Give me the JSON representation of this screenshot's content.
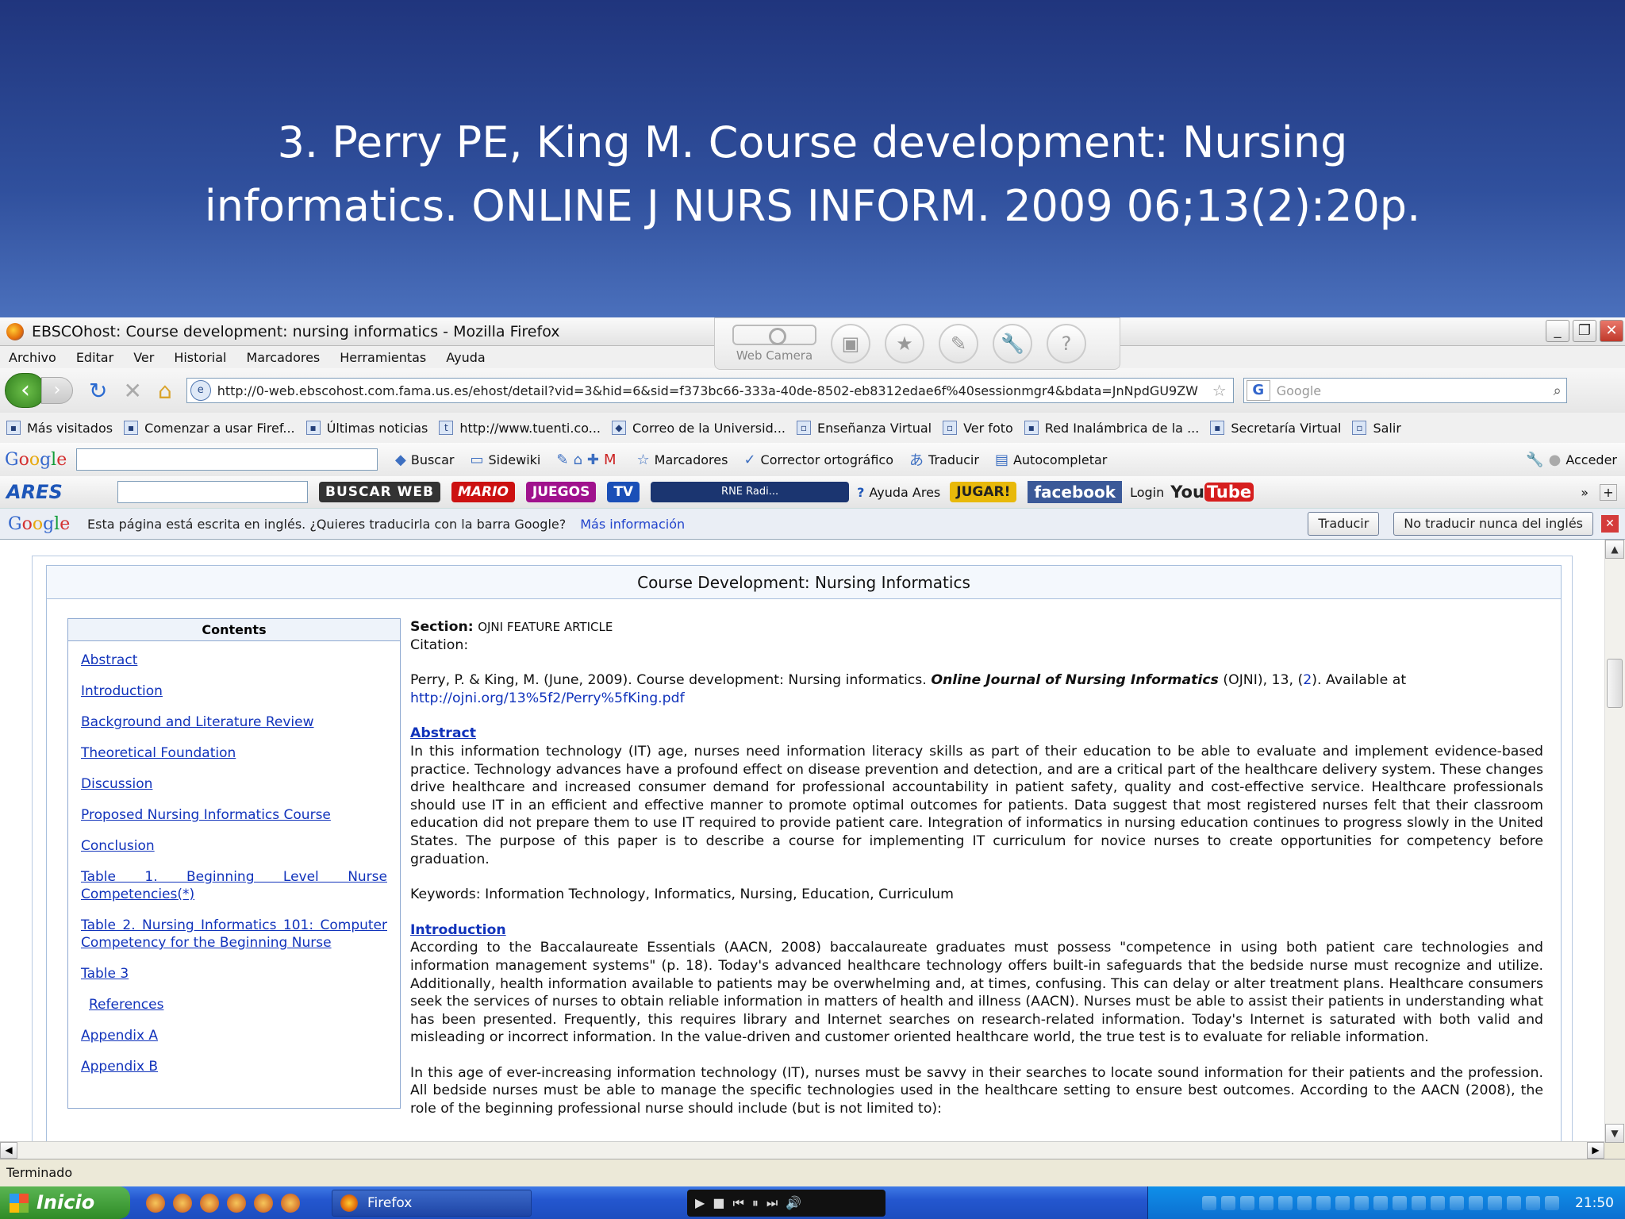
{
  "slide": {
    "title_line1": "3. Perry PE, King M. Course development: Nursing",
    "title_line2": "informatics. ONLINE J NURS INFORM. 2009 06;13(2):20p."
  },
  "window": {
    "title": "EBSCOhost: Course development: nursing informatics - Mozilla Firefox"
  },
  "webcam": {
    "label": "Web Camera"
  },
  "menu": [
    "Archivo",
    "Editar",
    "Ver",
    "Historial",
    "Marcadores",
    "Herramientas",
    "Ayuda"
  ],
  "nav": {
    "url": "http://0-web.ebscohost.com.fama.us.es/ehost/detail?vid=3&hid=6&sid=f373bc66-333a-40de-8502-eb8312edae6f%40sessionmgr4&bdata=JnNpdGU9ZW",
    "search_placeholder": "Google"
  },
  "bookmarks": [
    "Más visitados",
    "Comenzar a usar Firef...",
    "Últimas noticias",
    "http://www.tuenti.co...",
    "Correo de la Universid...",
    "Enseñanza Virtual",
    "Ver foto",
    "Red Inalámbrica de la ...",
    "Secretaría Virtual",
    "Salir"
  ],
  "google_toolbar": {
    "logo": "Google",
    "items": [
      "Buscar",
      "Sidewiki",
      "Marcadores",
      "Corrector ortográfico",
      "Traducir",
      "Autocompletar",
      "Acceder"
    ]
  },
  "ares_toolbar": {
    "logo": "ARES",
    "buscar": "BUSCAR WEB",
    "mario": "MARIO",
    "juegos": "JUEGOS",
    "tv": "TV",
    "radio": "RNE Radi...",
    "ayuda": "Ayuda Ares",
    "jugar": "JUGAR!",
    "facebook": "facebook",
    "login": "Login",
    "youtube_you": "You",
    "youtube_tube": "Tube"
  },
  "translate_bar": {
    "logo": "Google",
    "message": "Esta página está escrita en inglés. ¿Quieres traducirla con la barra Google?",
    "more": "Más información",
    "translate": "Traducir",
    "never": "No traducir nunca del inglés"
  },
  "doc": {
    "title": "Course Development: Nursing Informatics",
    "contents_title": "Contents",
    "contents": [
      "Abstract",
      "Introduction",
      "Background and Literature Review",
      "Theoretical Foundation",
      "Discussion",
      "Proposed Nursing Informatics Course",
      "Conclusion",
      "Table 1. Beginning Level Nurse Competencies(*)",
      "Table 2. Nursing Informatics 101: Computer Competency for the Beginning Nurse",
      "Table 3",
      "References",
      "Appendix A",
      "Appendix B"
    ],
    "section_label": "Section:",
    "section_value": "OJNI FEATURE ARTICLE",
    "citation_label": "Citation:",
    "citation_pre": "Perry, P. & King, M. (June, 2009). Course development: Nursing informatics.",
    "citation_journal": "Online Journal of Nursing Informatics",
    "citation_mid": "(OJNI), 13, (",
    "citation_issue": "2",
    "citation_post": "). Available at",
    "citation_url": "http://ojni.org/13%5f2/Perry%5fKing.pdf",
    "abstract_heading": "Abstract",
    "abstract_text": "In this information technology (IT) age, nurses need information literacy skills as part of their education to be able to evaluate and implement evidence-based practice. Technology advances have a profound effect on disease prevention and detection, and are a critical part of the healthcare delivery system. These changes drive healthcare and increased consumer demand for professional accountability in patient safety, quality and cost-effective service. Healthcare professionals should use IT in an efficient and effective manner to promote optimal outcomes for patients. Data suggest that most registered nurses felt that their classroom education did not prepare them to use IT required to provide patient care. Integration of informatics in nursing education continues to progress slowly in the United States. The purpose of this paper is to describe a course for implementing IT curriculum for novice nurses to create opportunities for competency before graduation.",
    "keywords": "Keywords: Information Technology, Informatics, Nursing, Education, Curriculum",
    "intro_heading": "Introduction",
    "intro_p1": "According to the Baccalaureate Essentials (AACN, 2008) baccalaureate graduates must possess \"competence in using both patient care technologies and information management systems\" (p. 18). Today's advanced healthcare technology offers built-in safeguards that the bedside nurse must recognize and utilize. Additionally, health information available to patients may be overwhelming and, at times, confusing. This can delay or alter treatment plans. Healthcare consumers seek the services of nurses to obtain reliable information in matters of health and illness (AACN). Nurses must be able to assist their patients in understanding what has been presented. Frequently, this requires library and Internet searches on research-related information. Today's Internet is saturated with both valid and misleading or incorrect information. In the value-driven and customer oriented healthcare world, the true test is to evaluate for reliable information.",
    "intro_p2": "In this age of ever-increasing information technology (IT), nurses must be savvy in their searches to locate sound information for their patients and the profession. All bedside nurses must be able to manage the specific technologies used in the healthcare setting to ensure best outcomes. According to the AACN (2008), the role of the beginning professional nurse should include (but is not limited to):"
  },
  "status": {
    "text": "Terminado"
  },
  "taskbar": {
    "start": "Inicio",
    "task": "Firefox",
    "clock": "21:50"
  }
}
